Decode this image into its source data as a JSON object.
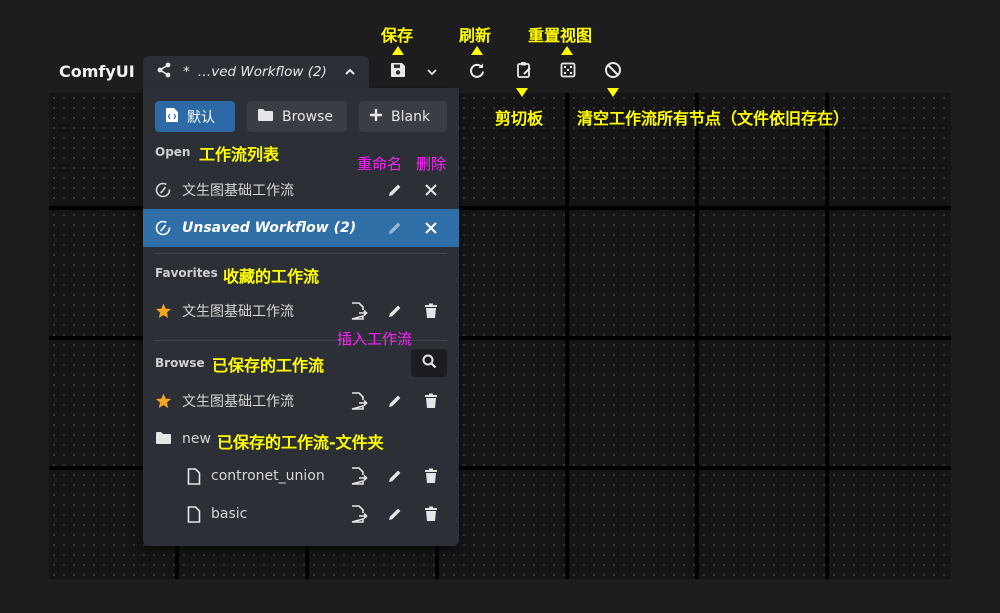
{
  "app": {
    "title": "ComfyUI"
  },
  "workflow_tab": {
    "modified_mark": "*",
    "title": "…ved Workflow (2)",
    "icon": "share-icon",
    "toggle_icon": "chevron-up-icon"
  },
  "toolbar": {
    "save_icon": "floppy-disk-icon",
    "save_menu_icon": "chevron-down-icon",
    "refresh_icon": "refresh-icon",
    "clipboard_icon": "clipboard-icon",
    "reset_view_icon": "fit-view-icon",
    "clear_icon": "ban-icon"
  },
  "menu": {
    "buttons": {
      "default": "默认",
      "browse": "Browse",
      "blank": "Blank"
    },
    "open": {
      "title": "Open",
      "items": [
        {
          "label": "文生图基础工作流",
          "active": false
        },
        {
          "label": "Unsaved Workflow (2)",
          "active": true
        }
      ]
    },
    "favorites": {
      "title": "Favorites",
      "items": [
        {
          "label": "文生图基础工作流"
        }
      ]
    },
    "browse": {
      "title": "Browse",
      "items": [
        {
          "label": "文生图基础工作流"
        }
      ],
      "folder": {
        "name": "new",
        "files": [
          {
            "label": "contronet_union"
          },
          {
            "label": "basic"
          }
        ]
      }
    }
  },
  "annotations": {
    "save": "保存",
    "refresh": "刷新",
    "reset_view": "重置视图",
    "clipboard": "剪切板",
    "clear": "清空工作流所有节点（文件依旧存在）",
    "workflow_list": "工作流列表",
    "rename": "重命名",
    "delete": "删除",
    "favorites": "收藏的工作流",
    "insert": "插入工作流",
    "saved": "已保存的工作流",
    "saved_folder": "已保存的工作流-文件夹"
  },
  "colors": {
    "accent": "#2d6aa5",
    "annotation_yellow": "#ffff00",
    "annotation_magenta": "#ff22ff",
    "star": "#f5a623"
  }
}
